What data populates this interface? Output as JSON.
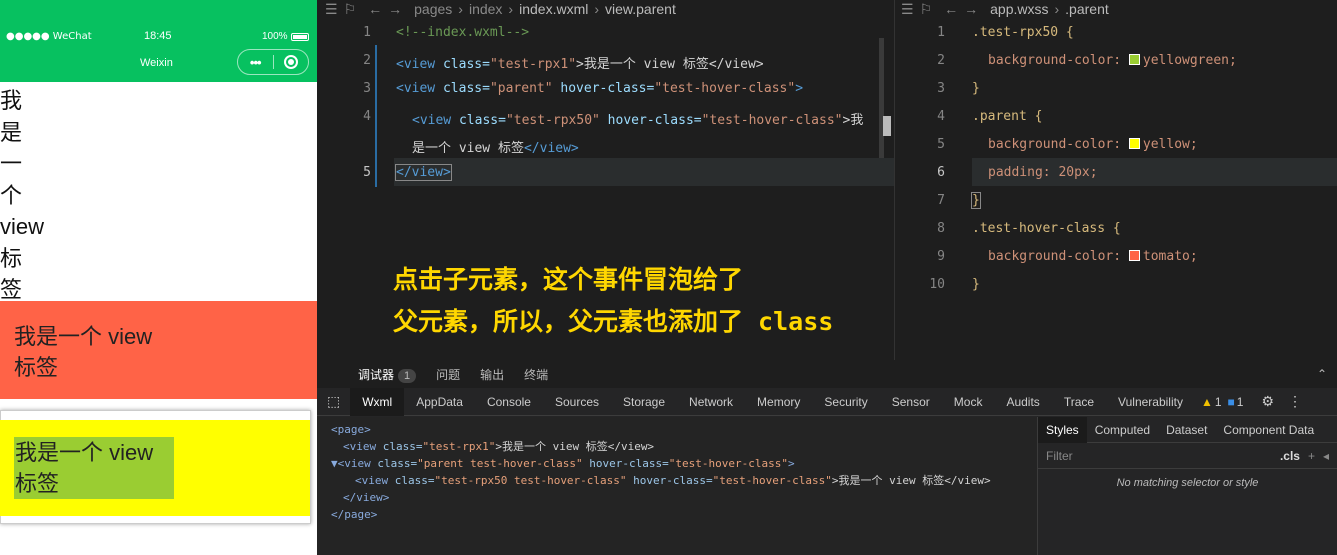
{
  "simulator": {
    "carrier": "●●●●● WeChat",
    "time": "18:45",
    "battery": "100%",
    "nav_title": "Weixin",
    "capsule_more": "•••",
    "rpx1_chars": [
      "我",
      "是",
      "一",
      "个",
      "view",
      "标",
      "签"
    ],
    "parent_text_1": "我是一个 view",
    "parent_text_2": "标签",
    "hover_text_1": "我是一个 view",
    "hover_text_2": "标签",
    "colors": {
      "navbar": "#07c160",
      "parent": "#ff6347",
      "hover": "#ffff00",
      "child": "#9acd32"
    }
  },
  "editor_left": {
    "breadcrumb": [
      "pages",
      "index",
      "index.wxml",
      "view.parent"
    ],
    "lines": [
      "1",
      "2",
      "3",
      "4",
      "",
      "5"
    ],
    "code": {
      "l1": "<!--index.wxml-->",
      "l2_tag_open": "<view",
      "l2_attr": " class=",
      "l2_val": "\"test-rpx1\"",
      "l2_text": ">我是一个 view 标签</view>",
      "l3_tag_open": "<view",
      "l3_attr1": " class=",
      "l3_val1": "\"parent\"",
      "l3_attr2": " hover-class=",
      "l3_val2": "\"test-hover-class\"",
      "l3_end": ">",
      "l4_tag_open": "<view",
      "l4_attr1": " class=",
      "l4_val1": "\"test-rpx50\"",
      "l4_attr2": " hover-class=",
      "l4_val2": "\"test-hover-class\"",
      "l4_text": ">我",
      "l4b_text": "是一个 view 标签",
      "l4b_close": "</view>",
      "l5": "</view>"
    }
  },
  "editor_right": {
    "breadcrumb": [
      "app.wxss",
      ".parent"
    ],
    "lines": [
      "1",
      "2",
      "3",
      "4",
      "5",
      "6",
      "7",
      "8",
      "9",
      "10"
    ],
    "code": {
      "s1": ".test-rpx50 {",
      "p1": "background-color:",
      "v1": "yellowgreen;",
      "b": "}",
      "s2": ".parent {",
      "p2": "background-color:",
      "v2": "yellow;",
      "p3": "padding:",
      "v3": "20px;",
      "s3": ".test-hover-class {",
      "p4": "background-color:",
      "v4": "tomato;"
    },
    "swatches": {
      "yellowgreen": "#9acd32",
      "yellow": "#ffff00",
      "tomato": "#ff6347"
    }
  },
  "overlay": {
    "line1": "点击子元素，这个事件冒泡给了",
    "line2": "父元素，所以，父元素也添加了 class"
  },
  "devtools": {
    "top": {
      "debugger": "调试器",
      "debugger_count": "1",
      "problems": "问题",
      "output": "输出",
      "terminal": "终端"
    },
    "tabs": [
      "Wxml",
      "AppData",
      "Console",
      "Sources",
      "Storage",
      "Network",
      "Memory",
      "Security",
      "Sensor",
      "Mock",
      "Audits",
      "Trace",
      "Vulnerability"
    ],
    "warn_count": "1",
    "info_count": "1",
    "wxml": {
      "page_open": "<page>",
      "r1_tag": "<view",
      "r1_attr": " class=",
      "r1_val": "\"test-rpx1\"",
      "r1_text": ">我是一个 view 标签</view>",
      "r2_tag": "▼<view",
      "r2_attr": " class=",
      "r2_val": "\"parent test-hover-class\"",
      "r2_attr2": " hover-class=",
      "r2_val2": "\"test-hover-class\"",
      "r2_end": ">",
      "r3_tag": "<view",
      "r3_attr": " class=",
      "r3_val": "\"test-rpx50 test-hover-class\"",
      "r3_attr2": " hover-class=",
      "r3_val2": "\"test-hover-class\"",
      "r3_text": ">我是一个 view 标签</view>",
      "r4": "</view>",
      "page_close": "</page>"
    },
    "right_tabs": [
      "Styles",
      "Computed",
      "Dataset",
      "Component Data"
    ],
    "filter_placeholder": "Filter",
    "cls": ".cls",
    "plus": "+",
    "no_match": "No matching selector or style"
  }
}
